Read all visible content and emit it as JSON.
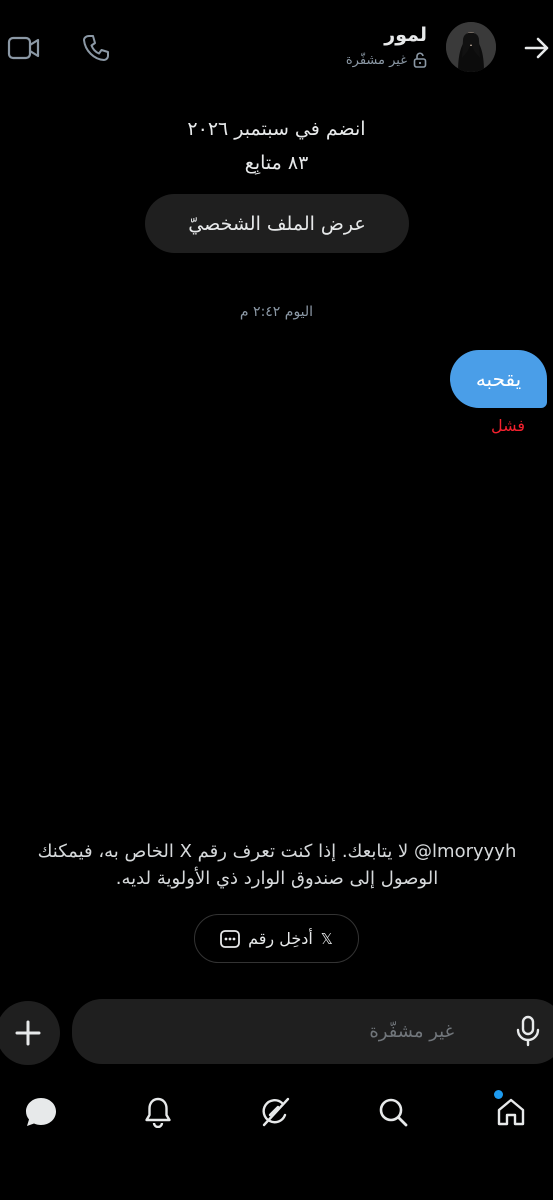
{
  "header": {
    "name": "لمور",
    "encryption_status": "غير مشفّرة",
    "back_icon": "arrow-right-icon",
    "call_icon": "phone-icon",
    "video_icon": "video-icon"
  },
  "profile": {
    "joined": "انضم في سبتمبر ٢٠٢٦",
    "followers": "٨٣ متابِع",
    "view_profile_label": "عرض الملف الشخصيّ"
  },
  "conversation": {
    "timestamp": "اليوم ٢:٤٢ م",
    "messages": [
      {
        "text": "يقحبه",
        "status": "فشل",
        "outgoing": true
      }
    ]
  },
  "notice": {
    "handle": "@lmoryyyh",
    "text": " لا يتابعك. إذا كنت تعرف رقم X الخاص به، فيمكنك الوصول إلى صندوق الوارد ذي الأولوية لديه.",
    "enter_number_label": "أدخِل رقم",
    "x_logo": "𝕏"
  },
  "composer": {
    "placeholder": "غير مشفّرة"
  },
  "nav": {
    "items": [
      "home-icon",
      "search-icon",
      "grok-icon",
      "notifications-icon",
      "messages-icon"
    ]
  },
  "colors": {
    "background": "#000000",
    "bubble": "#4a9ee8",
    "failed": "#f4212e",
    "accent": "#1d9bf0"
  }
}
